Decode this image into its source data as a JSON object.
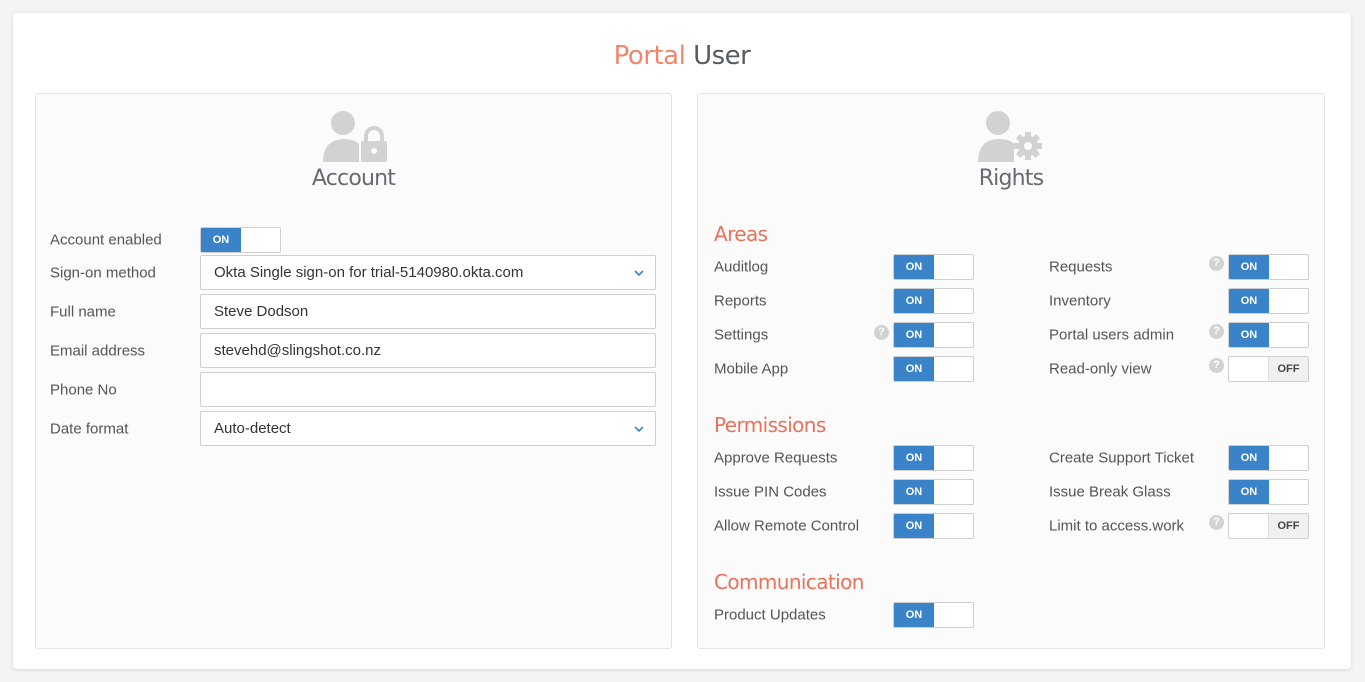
{
  "page": {
    "title_part1": "Portal",
    "title_part2": "User"
  },
  "colors": {
    "accent": "#f0876a",
    "section": "#e8715a",
    "toggle_on": "#3b83c8"
  },
  "account": {
    "title": "Account",
    "icon": "user-lock-icon",
    "enabled_label": "Account enabled",
    "enabled_state": "ON",
    "fields": {
      "signon": {
        "label": "Sign-on method",
        "value": "Okta Single sign-on for trial-5140980.okta.com"
      },
      "fullname": {
        "label": "Full name",
        "value": "Steve Dodson"
      },
      "email": {
        "label": "Email address",
        "value": "stevehd@slingshot.co.nz"
      },
      "phone": {
        "label": "Phone No",
        "value": ""
      },
      "dateformat": {
        "label": "Date format",
        "value": "Auto-detect"
      }
    }
  },
  "rights": {
    "title": "Rights",
    "icon": "user-gear-icon",
    "areas": {
      "title": "Areas",
      "items": [
        {
          "label": "Auditlog",
          "state": "ON"
        },
        {
          "label": "Requests",
          "state": "ON",
          "help": "?"
        },
        {
          "label": "Reports",
          "state": "ON"
        },
        {
          "label": "Inventory",
          "state": "ON"
        },
        {
          "label": "Settings",
          "state": "ON",
          "help": "?"
        },
        {
          "label": "Portal users admin",
          "state": "ON",
          "help": "?"
        },
        {
          "label": "Mobile App",
          "state": "ON"
        },
        {
          "label": "Read-only view",
          "state": "OFF",
          "help": "?"
        }
      ]
    },
    "permissions": {
      "title": "Permissions",
      "items": [
        {
          "label": "Approve Requests",
          "state": "ON"
        },
        {
          "label": "Create Support Ticket",
          "state": "ON"
        },
        {
          "label": "Issue PIN Codes",
          "state": "ON"
        },
        {
          "label": "Issue Break Glass",
          "state": "ON"
        },
        {
          "label": "Allow Remote Control",
          "state": "ON"
        },
        {
          "label": "Limit to access.work",
          "state": "OFF",
          "help": "?"
        }
      ]
    },
    "communication": {
      "title": "Communication",
      "items": [
        {
          "label": "Product Updates",
          "state": "ON"
        }
      ]
    }
  }
}
